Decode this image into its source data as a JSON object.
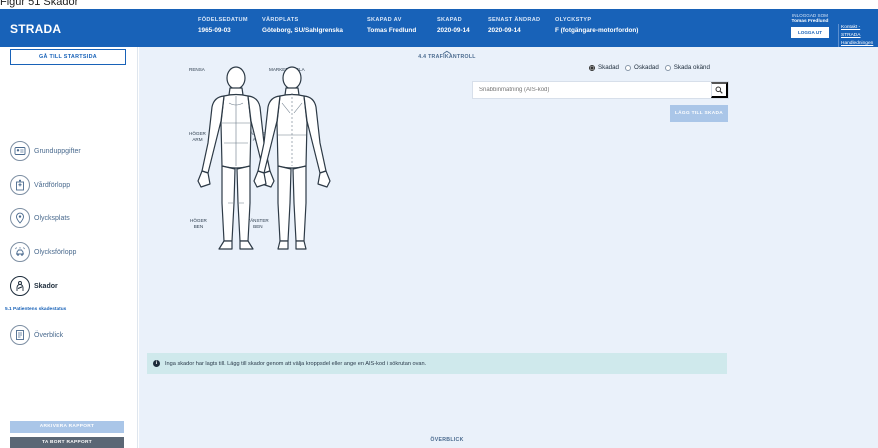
{
  "figure_caption": "Figur 51 Skador",
  "header": {
    "brand": "STRADA",
    "fields": [
      {
        "label": "FÖDELSEDATUM",
        "value": "1965-09-03"
      },
      {
        "label": "VÅRDPLATS",
        "value": "Göteborg, SU/Sahlgrenska"
      },
      {
        "label": "SKAPAD AV",
        "value": "Tomas Fredlund"
      },
      {
        "label": "SKAPAD",
        "value": "2020-09-14"
      },
      {
        "label": "SENAST ÄNDRAD",
        "value": "2020-09-14"
      },
      {
        "label": "OLYCKSTYP",
        "value": "F (fotgängare-motorfordon)"
      }
    ],
    "login_label": "INLOGGAD SOM",
    "login_user": "Tomas Fredlund",
    "logout_label": "LOGGA UT",
    "links": [
      "Kontakt - STRADA",
      "Handledningen"
    ]
  },
  "sidebar": {
    "start_label": "GÅ TILL STARTSIDA",
    "items": [
      {
        "label": "Grunduppgifter",
        "icon": "id-card-icon"
      },
      {
        "label": "Vårdförlopp",
        "icon": "hospital-icon"
      },
      {
        "label": "Olycksplats",
        "icon": "map-pin-icon"
      },
      {
        "label": "Olycksförlopp",
        "icon": "crash-icon"
      },
      {
        "label": "Skador",
        "icon": "bandage-icon"
      },
      {
        "label": "Överblick",
        "icon": "document-icon"
      }
    ],
    "subitem": "5.1 Patientens skadestatus",
    "archive_label": "ARKIVERA RAPPORT",
    "delete_label": "TA BORT RAPPORT"
  },
  "main": {
    "top_link": "4.4 TRAFIKANTROLL",
    "bottom_link": "ÖVERBLICK",
    "body_labels": {
      "reset": "RENSA",
      "mark_all": "MARKERA HELA",
      "right_arm": "HÖGER\nARM",
      "left_arm": "VÄNSTER\nARM",
      "right_leg": "HÖGER\nBEN",
      "left_leg": "VÄNSTER\nBEN"
    },
    "radio_options": [
      {
        "label": "Skadad",
        "selected": true
      },
      {
        "label": "Oskadad",
        "selected": false
      },
      {
        "label": "Skada okänd",
        "selected": false
      }
    ],
    "search_placeholder": "Snabbinmatning (AIS-kod)",
    "add_label": "LÄGG TILL SKADA",
    "info_text": "Inga skador har lagts till. Lägg till skador genom att välja kroppsdel eller ange en AIS-kod i sökrutan ovan."
  },
  "colors": {
    "header": "#1862b8",
    "main_bg": "#eaf1fa",
    "info_bg": "#cfe9ec",
    "disabled_button": "#aac6e8"
  }
}
